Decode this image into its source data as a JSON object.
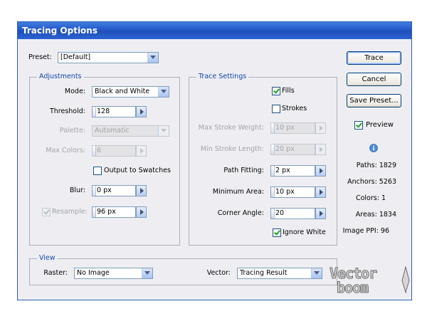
{
  "dialog": {
    "title": "Tracing Options"
  },
  "preset": {
    "label": "Preset:",
    "value": "[Default]"
  },
  "adjustments": {
    "legend": "Adjustments",
    "mode": {
      "label": "Mode:",
      "value": "Black and White"
    },
    "threshold": {
      "label": "Threshold:",
      "value": "128"
    },
    "palette": {
      "label": "Palette:",
      "value": "Automatic"
    },
    "max_colors": {
      "label": "Max Colors:",
      "value": "6"
    },
    "output_to_swatches": {
      "label": "Output to Swatches",
      "checked": false
    },
    "blur": {
      "label": "Blur:",
      "value": "0 px"
    },
    "resample": {
      "label": "Resample:",
      "value": "96 px",
      "checked": true
    }
  },
  "trace_settings": {
    "legend": "Trace Settings",
    "fills": {
      "label": "Fills",
      "checked": true
    },
    "strokes": {
      "label": "Strokes",
      "checked": false
    },
    "max_stroke_weight": {
      "label": "Max Stroke Weight:",
      "value": "10 px"
    },
    "min_stroke_length": {
      "label": "Min Stroke Length:",
      "value": "20 px"
    },
    "path_fitting": {
      "label": "Path Fitting:",
      "value": "2 px"
    },
    "minimum_area": {
      "label": "Minimum Area:",
      "value": "10 px"
    },
    "corner_angle": {
      "label": "Corner Angle:",
      "value": "20"
    },
    "ignore_white": {
      "label": "Ignore White",
      "checked": true
    }
  },
  "view": {
    "legend": "View",
    "raster": {
      "label": "Raster:",
      "value": "No Image"
    },
    "vector": {
      "label": "Vector:",
      "value": "Tracing Result"
    }
  },
  "buttons": {
    "trace": "Trace",
    "cancel": "Cancel",
    "save_preset": "Save Preset..."
  },
  "preview": {
    "label": "Preview",
    "checked": true
  },
  "stats": {
    "paths": "Paths: 1829",
    "anchors": "Anchors: 5263",
    "colors": "Colors: 1",
    "areas": "Areas: 1834",
    "image_ppi": "Image PPI: 96"
  },
  "watermark": {
    "line1": "Vector",
    "line2": "boom"
  },
  "colors": {
    "title_bar": "#2458c8",
    "dialog_bg": "#eeeef2",
    "legend_text": "#1346b0",
    "check_green": "#21a121"
  },
  "icons": {
    "info": "info-icon"
  }
}
